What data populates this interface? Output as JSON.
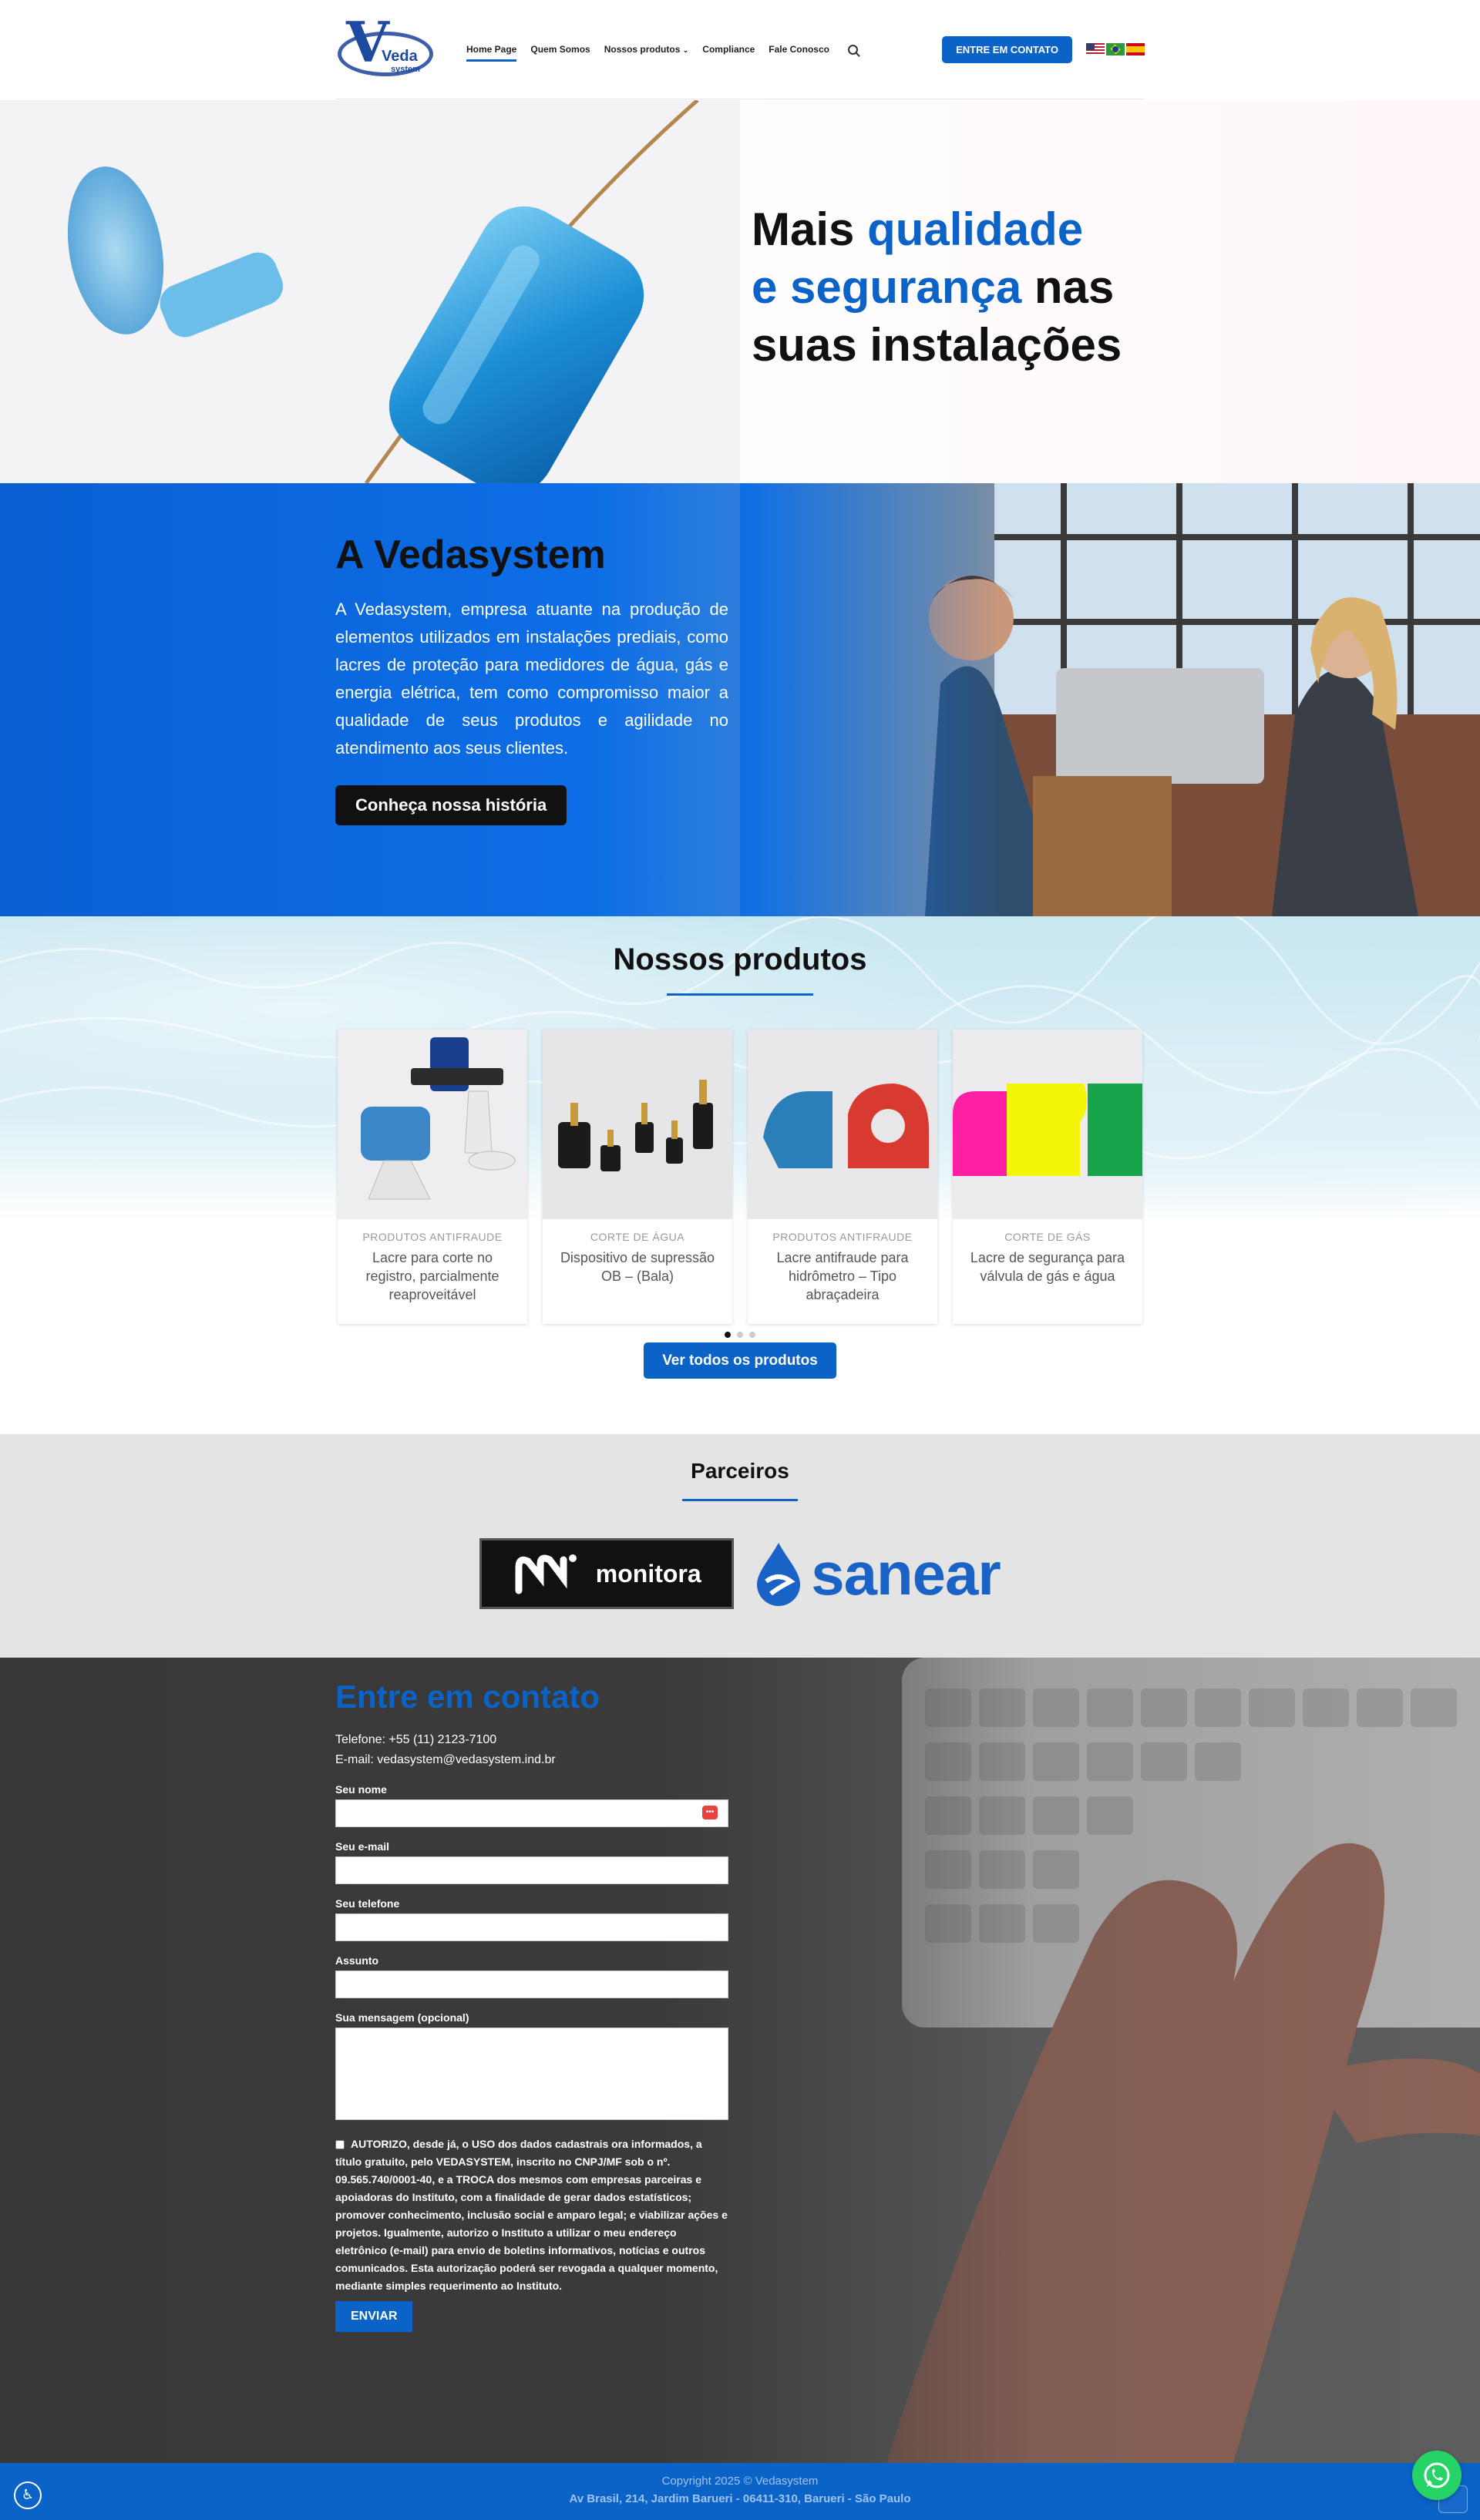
{
  "header": {
    "logo_text": "Veda",
    "logo_sub": "system",
    "nav": [
      {
        "label": "Home Page"
      },
      {
        "label": "Quem Somos"
      },
      {
        "label": "Nossos produtos"
      },
      {
        "label": "Compliance"
      },
      {
        "label": "Fale Conosco"
      }
    ],
    "contact_button": "ENTRE EM CONTATO"
  },
  "hero": {
    "line1_plain": "Mais ",
    "line1_blue": "qualidade",
    "line2_blue": "e segurança",
    "line2_plain": " nas",
    "line3": "suas instalações"
  },
  "about": {
    "title": "A Vedasystem",
    "text": "A Vedasystem, empresa atuante na produção de elementos utilizados em instalações prediais, como lacres de proteção para medidores de água, gás e energia elétrica, tem como compromisso maior a qualidade de seus produtos e agilidade no atendimento aos seus clientes.",
    "button": "Conheça nossa história"
  },
  "products": {
    "title": "Nossos produtos",
    "items": [
      {
        "category": "PRODUTOS ANTIFRAUDE",
        "name": "Lacre para corte no registro, parcialmente reaproveitável"
      },
      {
        "category": "CORTE DE ÁGUA",
        "name": "Dispositivo de supressão OB – (Bala)"
      },
      {
        "category": "PRODUTOS ANTIFRAUDE",
        "name": "Lacre antifraude para hidrômetro – Tipo abraçadeira"
      },
      {
        "category": "CORTE DE GÁS",
        "name": "Lacre de segurança para válvula de gás e água"
      }
    ],
    "button": "Ver todos os produtos"
  },
  "partners": {
    "title": "Parceiros",
    "logos": [
      "monitora",
      "sanear"
    ]
  },
  "contact": {
    "title": "Entre em contato",
    "phone": "Telefone: +55 (11) 2123-7100",
    "email": "E-mail: vedasystem@vedasystem.ind.br",
    "labels": {
      "name": "Seu nome",
      "email": "Seu e-mail",
      "phone": "Seu telefone",
      "subject": "Assunto",
      "message": "Sua mensagem (opcional)"
    },
    "consent": "AUTORIZO, desde já, o USO dos dados cadastrais ora informados, a título gratuito, pelo VEDASYSTEM, inscrito no CNPJ/MF sob o nº. 09.565.740/0001-40, e a TROCA dos mesmos com empresas parceiras e apoiadoras do Instituto, com a finalidade de gerar dados estatísticos; promover conhecimento, inclusão social e amparo legal; e viabilizar ações e projetos. Igualmente, autorizo o Instituto a utilizar o meu endereço eletrônico (e-mail) para envio de boletins informativos, notícias e outros comunicados. Esta autorização poderá ser revogada a qualquer momento, mediante simples requerimento ao Instituto.",
    "send": "ENVIAR"
  },
  "footer": {
    "copyright": "Copyright 2025 © Vedasystem",
    "address": "Av Brasil, 214, Jardim Barueri - 06411-310, Barueri - São Paulo"
  },
  "colors": {
    "primary": "#0b63c8",
    "dark": "#111111",
    "whatsapp": "#25d366"
  }
}
